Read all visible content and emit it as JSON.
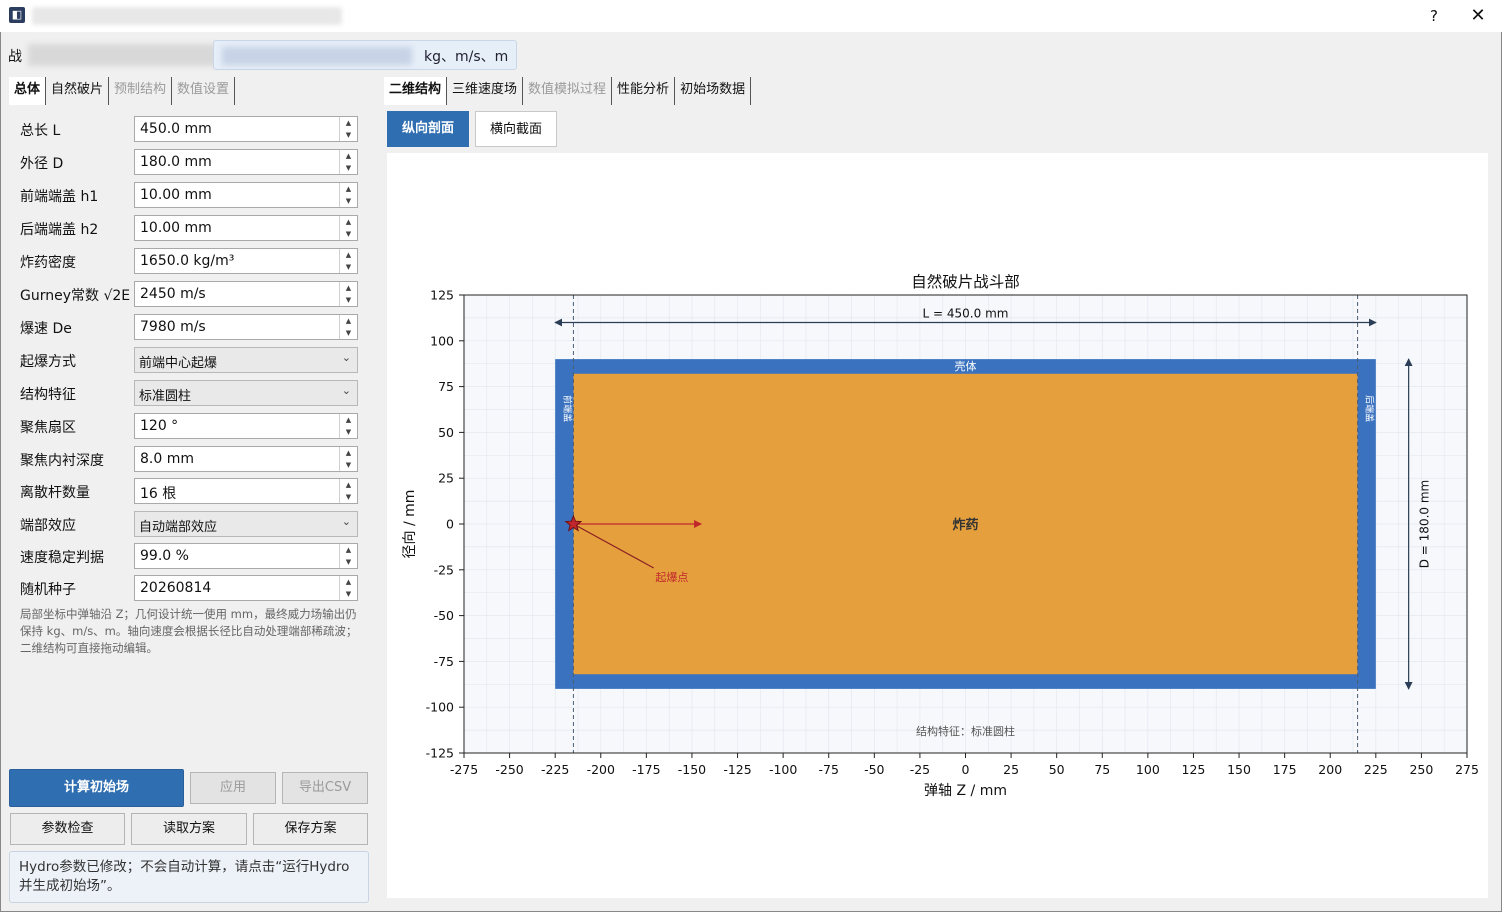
{
  "titlebar": {
    "help": "?",
    "close": "✕",
    "app_icon": "app-icon"
  },
  "top": {
    "label_prefix": "战",
    "units_text": "kg、m/s、m"
  },
  "left_tabs": [
    {
      "label": "总体",
      "state": "active"
    },
    {
      "label": "自然破片",
      "state": "normal"
    },
    {
      "label": "预制结构",
      "state": "disabled"
    },
    {
      "label": "数值设置",
      "state": "disabled"
    }
  ],
  "right_tabs": [
    {
      "label": "二维结构",
      "state": "active"
    },
    {
      "label": "三维速度场",
      "state": "normal"
    },
    {
      "label": "数值模拟过程",
      "state": "disabled"
    },
    {
      "label": "性能分析",
      "state": "normal"
    },
    {
      "label": "初始场数据",
      "state": "normal"
    }
  ],
  "params": [
    {
      "label": "总长 L",
      "value": "450.0 mm",
      "kind": "spin"
    },
    {
      "label": "外径 D",
      "value": "180.0 mm",
      "kind": "spin"
    },
    {
      "label": "前端端盖 h1",
      "value": "10.00 mm",
      "kind": "spin"
    },
    {
      "label": "后端端盖 h2",
      "value": "10.00 mm",
      "kind": "spin"
    },
    {
      "label": "炸药密度",
      "value": "1650.0 kg/m³",
      "kind": "spin"
    },
    {
      "label": "Gurney常数 √2E",
      "value": "2450 m/s",
      "kind": "spin"
    },
    {
      "label": "爆速 De",
      "value": "7980 m/s",
      "kind": "spin"
    },
    {
      "label": "起爆方式",
      "value": "前端中心起爆",
      "kind": "combo"
    },
    {
      "label": "结构特征",
      "value": "标准圆柱",
      "kind": "combo"
    },
    {
      "label": "聚焦扇区",
      "value": "120 °",
      "kind": "spin"
    },
    {
      "label": "聚焦内衬深度",
      "value": "8.0 mm",
      "kind": "spin"
    },
    {
      "label": "离散杆数量",
      "value": "16 根",
      "kind": "spin"
    },
    {
      "label": "端部效应",
      "value": "自动端部效应",
      "kind": "combo"
    },
    {
      "label": "速度稳定判据",
      "value": "99.0 %",
      "kind": "spin"
    },
    {
      "label": "随机种子",
      "value": "20260814",
      "kind": "spin"
    }
  ],
  "note": "局部坐标中弹轴沿 Z；几何设计统一使用 mm，最终威力场输出仍保持 kg、m/s、m。轴向速度会根据长径比自动处理端部稀疏波；二维结构可直接拖动编辑。",
  "buttons": {
    "compute": "计算初始场",
    "apply": "应用",
    "export_csv": "导出CSV",
    "check": "参数检查",
    "load": "读取方案",
    "save": "保存方案"
  },
  "status": "Hydro参数已修改；不会自动计算，请点击“运行Hydro并生成初始场”。",
  "sub_tabs": {
    "longitudinal": "纵向剖面",
    "transverse": "横向截面"
  },
  "colors": {
    "shell": "#3a72bf",
    "explosive": "#e5a03d",
    "accent": "#2f6eb0",
    "initiation": "#c0272d"
  },
  "chart_data": {
    "type": "diagram",
    "title": "自然破片战斗部",
    "xlabel": "弹轴 Z / mm",
    "ylabel": "径向 / mm",
    "xlim": [
      -275,
      275
    ],
    "ylim": [
      -125,
      125
    ],
    "xticks": [
      -275,
      -250,
      -225,
      -200,
      -175,
      -150,
      -125,
      -100,
      -75,
      -50,
      -25,
      0,
      25,
      50,
      75,
      100,
      125,
      150,
      175,
      200,
      225,
      250,
      275
    ],
    "yticks": [
      125,
      100,
      75,
      50,
      25,
      0,
      -25,
      -50,
      -75,
      -100,
      -125
    ],
    "grid": true,
    "geometry": {
      "length_mm": 450.0,
      "diameter_mm": 180.0,
      "front_cap_mm": 10.0,
      "rear_cap_mm": 10.0,
      "shell_thickness_mm": 8.0,
      "initiation_point": [
        -215,
        0
      ]
    },
    "annotations": {
      "length": "L = 450.0 mm",
      "diameter": "D = 180.0 mm",
      "shell": "壳体",
      "explosive": "炸药",
      "front_cap": "前端盖",
      "rear_cap": "后端盖",
      "initiation": "起爆点",
      "structure": "结构特征：标准圆柱"
    }
  }
}
